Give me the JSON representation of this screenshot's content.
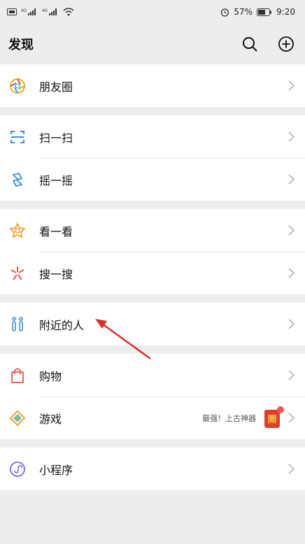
{
  "status_bar": {
    "left_icons": [
      "sim-icon",
      "signal-4g-icon",
      "signal-4g-icon",
      "wifi-icon"
    ],
    "net1": "4G",
    "net2": "4G",
    "alarm_icon": "alarm-icon",
    "battery": "57%",
    "time": "9:20"
  },
  "header": {
    "title": "发现",
    "search_icon": "search-icon",
    "add_icon": "plus-circle-icon"
  },
  "groups": [
    {
      "items": [
        {
          "id": "moments",
          "label": "朋友圈",
          "icon": "moments-icon"
        }
      ]
    },
    {
      "items": [
        {
          "id": "scan",
          "label": "扫一扫",
          "icon": "scan-icon"
        },
        {
          "id": "shake",
          "label": "摇一摇",
          "icon": "shake-icon"
        }
      ]
    },
    {
      "items": [
        {
          "id": "top-stories",
          "label": "看一看",
          "icon": "top-stories-icon"
        },
        {
          "id": "search",
          "label": "搜一搜",
          "icon": "search-sparkle-icon"
        }
      ]
    },
    {
      "items": [
        {
          "id": "nearby",
          "label": "附近的人",
          "icon": "people-nearby-icon"
        }
      ]
    },
    {
      "items": [
        {
          "id": "shopping",
          "label": "购物",
          "icon": "shopping-bag-icon"
        },
        {
          "id": "games",
          "label": "游戏",
          "icon": "games-icon",
          "promo_text": "最强！上古神器",
          "badge_glyph": "開"
        }
      ]
    },
    {
      "items": [
        {
          "id": "mini-programs",
          "label": "小程序",
          "icon": "mini-programs-icon"
        }
      ]
    }
  ],
  "colors": {
    "background": "#ededed",
    "annotation_arrow": "#d9302b",
    "badge_red": "#fa5151"
  }
}
